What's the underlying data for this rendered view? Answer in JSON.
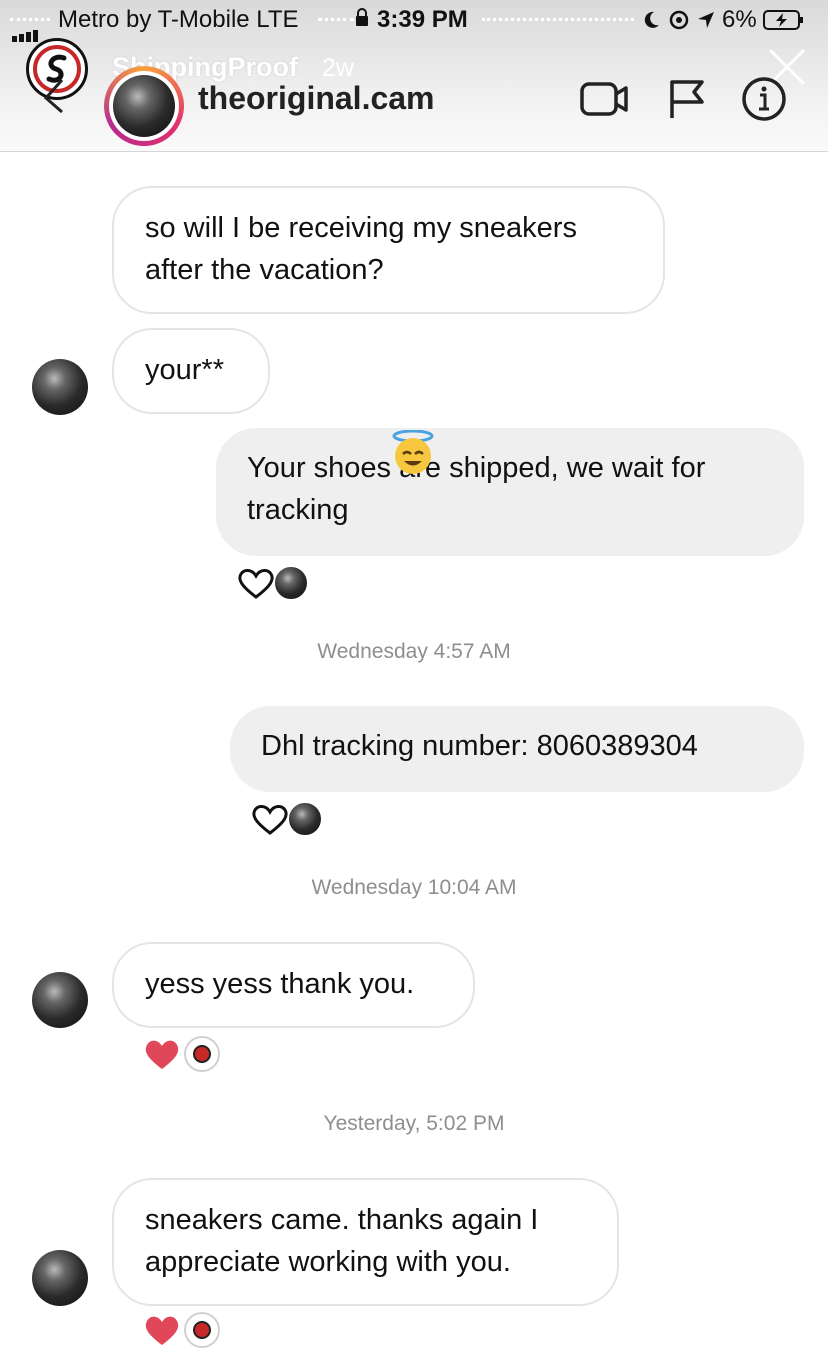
{
  "status_bar": {
    "carrier": "Metro by T-Mobile",
    "network": "LTE",
    "time": "3:39 PM",
    "battery": "6%"
  },
  "story": {
    "username": "ShippingProof",
    "age": "2w"
  },
  "conversation": {
    "name": "theoriginal.cam"
  },
  "messages": [
    {
      "text": "so will I be receiving my sneakers after the vacation?"
    },
    {
      "text": "your**"
    },
    {
      "text": "Your shoes are shipped, we wait for tracking"
    },
    {
      "text": "Dhl tracking number: 8060389304"
    },
    {
      "text": "yess yess thank you."
    },
    {
      "text": "sneakers came. thanks again I appreciate working with you."
    }
  ],
  "timestamps": [
    "Wednesday 4:57 AM",
    "Wednesday 10:04 AM",
    "Yesterday, 5:02 PM"
  ],
  "colors": {
    "heart_liked": "#e0485a",
    "bubble_out": "#efefef",
    "bubble_in_border": "#e4e4e4",
    "timestamp": "#8e8e8e"
  },
  "icons": [
    "video-call-icon",
    "flag-icon",
    "info-icon",
    "close-icon",
    "chevron-left-icon",
    "heart-icon"
  ]
}
